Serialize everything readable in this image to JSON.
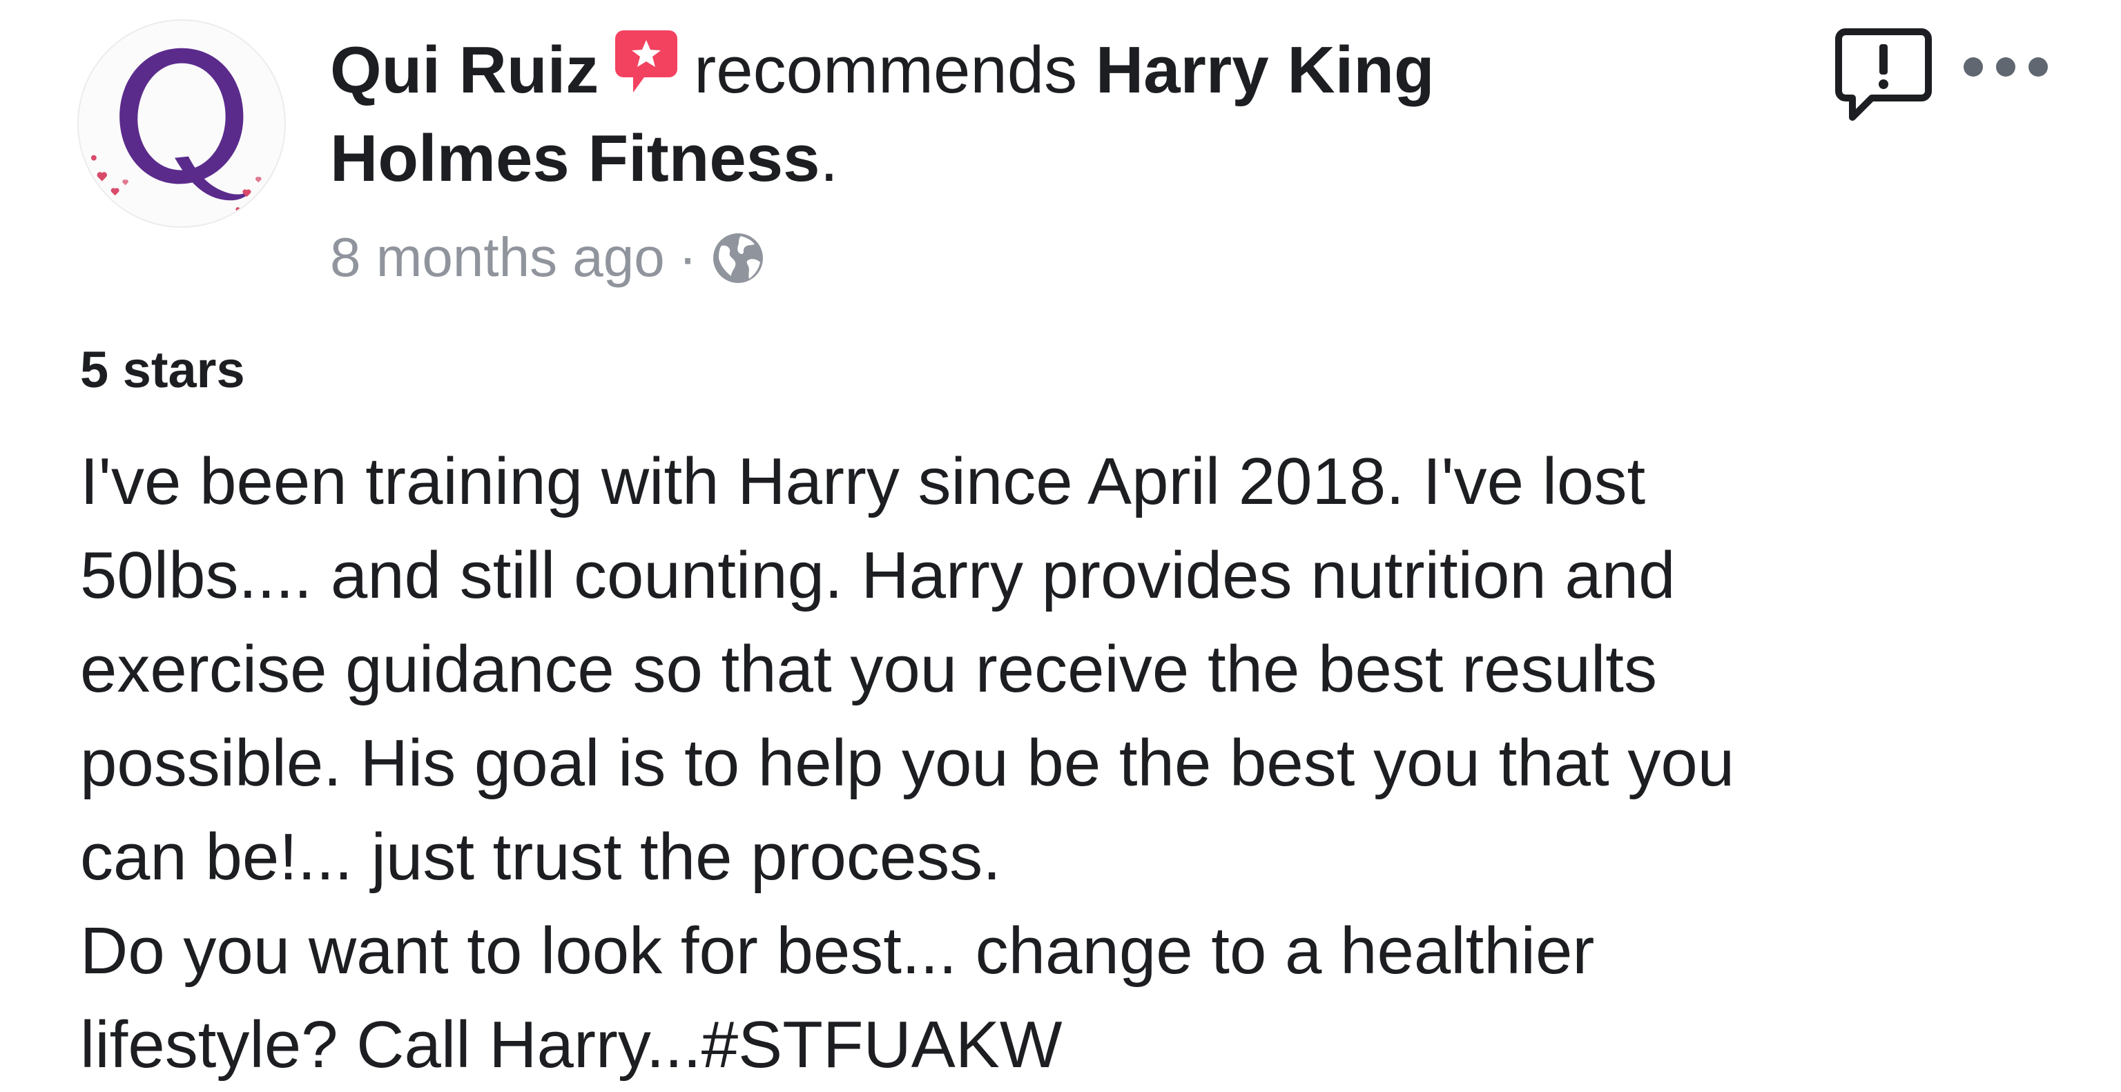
{
  "post": {
    "author": "Qui Ruiz",
    "action": "recommends",
    "page_name_line1": "Harry King",
    "page_name_line2": "Holmes Fitness",
    "period": ".",
    "timestamp": "8 months ago",
    "separator": "·",
    "privacy_icon": "globe-icon",
    "rating": "5 stars",
    "review_lines": [
      "I've been training with Harry since April 2018. I've lost",
      "50lbs.... and still counting. Harry provides nutrition and",
      "exercise guidance so that you receive the best results",
      "possible. His goal is to help you be the best you that you",
      "can be!... just trust the process.",
      "Do you want to look for best... change to a healthier",
      "lifestyle? Call Harry...#STFUAKW"
    ]
  },
  "icons": {
    "avatar": "avatar-q-logo",
    "recommendation_badge": "recommendation-badge-icon",
    "report": "report-icon",
    "more": "more-options-icon"
  },
  "colors": {
    "text": "#1c1e21",
    "meta": "#90949c",
    "badge": "#f3425f",
    "avatar_letter": "#5b2b8c"
  }
}
